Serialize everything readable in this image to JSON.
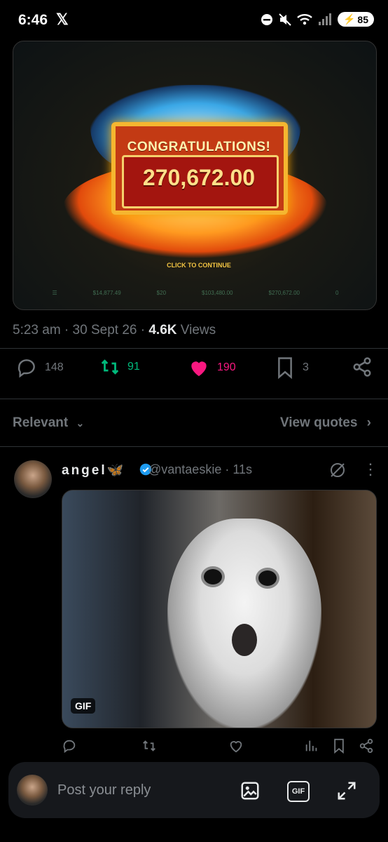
{
  "status_bar": {
    "time": "6:46",
    "app_icon": "x-logo",
    "battery": "85"
  },
  "post": {
    "media": {
      "congrats_text": "CONGRATULATIONS!",
      "win_amount": "270,672.00",
      "click_text": "CLICK TO CONTINUE",
      "hud": [
        "$14,877.49",
        "$20",
        "$103,480.00",
        "$270,672.00",
        "0"
      ]
    },
    "time": "5:23 am",
    "date": "30 Sept 26",
    "views_count": "4.6K",
    "views_label": "Views",
    "actions": {
      "replies": "148",
      "reposts": "91",
      "likes": "190",
      "bookmarks": "3"
    },
    "colors": {
      "repost": "#00ba7c",
      "like": "#f91880"
    }
  },
  "replies_header": {
    "sort_label": "Relevant",
    "quotes_label": "View quotes"
  },
  "reply": {
    "name": "angel",
    "name_emoji": "🦋",
    "handle": "@vantaeskie",
    "time": "11s",
    "gif_badge": "GIF"
  },
  "composer": {
    "placeholder": "Post your reply"
  }
}
